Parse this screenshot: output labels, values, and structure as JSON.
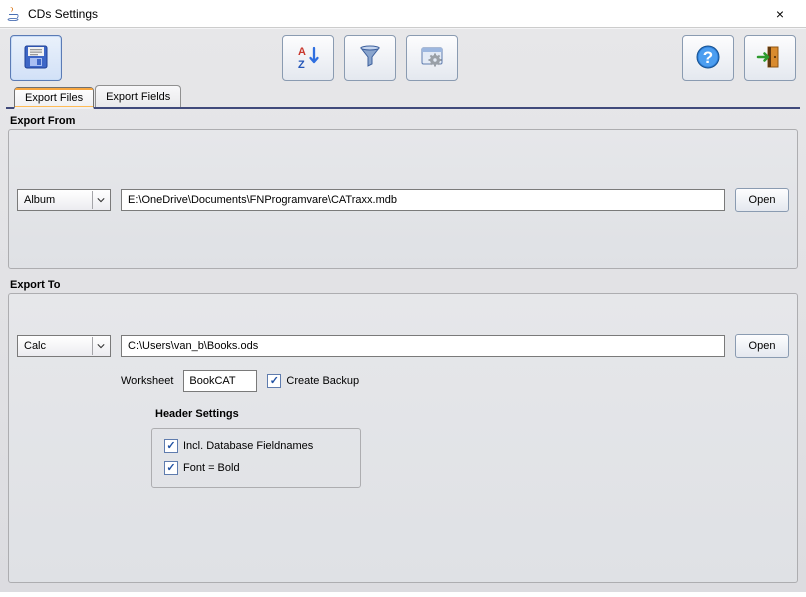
{
  "window": {
    "title": "CDs Settings",
    "close_icon": "×"
  },
  "toolbar": {
    "save": "save-icon",
    "sort": "sort-az-icon",
    "filter": "funnel-icon",
    "settings": "window-gear-icon",
    "help": "help-icon",
    "exit": "exit-door-icon"
  },
  "tabs": {
    "export_files": "Export Files",
    "export_fields": "Export Fields"
  },
  "export_from": {
    "legend": "Export From",
    "combo_value": "Album",
    "path": "E:\\OneDrive\\Documents\\FNProgramvare\\CATraxx.mdb",
    "open_label": "Open"
  },
  "export_to": {
    "legend": "Export To",
    "combo_value": "Calc",
    "path": "C:\\Users\\van_b\\Books.ods",
    "open_label": "Open",
    "worksheet_label": "Worksheet",
    "worksheet_value": "BookCAT",
    "create_backup_label": "Create Backup",
    "header_legend": "Header Settings",
    "incl_fieldnames_label": "Incl. Database Fieldnames",
    "font_bold_label": "Font = Bold"
  }
}
